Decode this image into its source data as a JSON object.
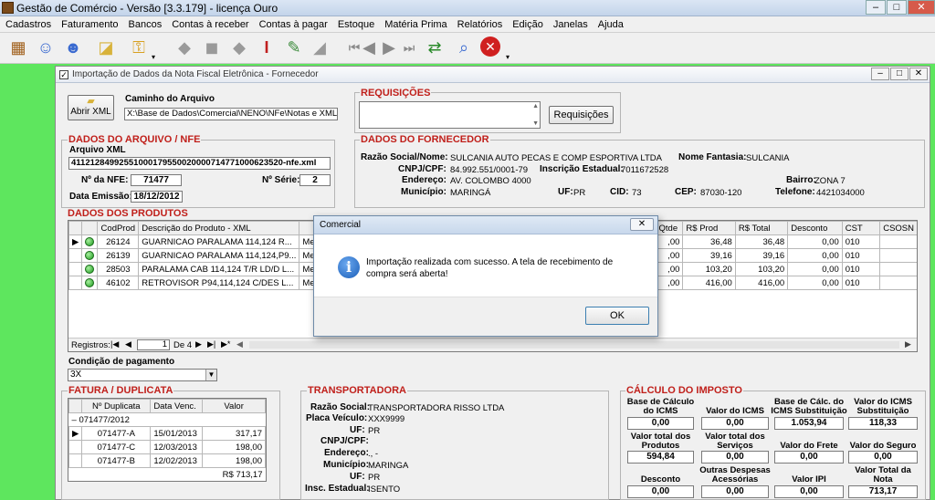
{
  "app": {
    "title": "Gestão de Comércio - Versão [3.3.179] - licença Ouro"
  },
  "menu": [
    "Cadastros",
    "Faturamento",
    "Bancos",
    "Contas à receber",
    "Contas à pagar",
    "Estoque",
    "Matéria Prima",
    "Relatórios",
    "Edição",
    "Janelas",
    "Ajuda"
  ],
  "window": {
    "title": "Importação de Dados da Nota Fiscal Eletrônica - Fornecedor"
  },
  "file": {
    "button": "Abrir XML",
    "label": "Caminho do Arquivo",
    "path": "X:\\Base de Dados\\Comercial\\NENO\\NFe\\Notas e XML recebi"
  },
  "requisicoes": {
    "title": "REQUISIÇÕES",
    "button": "Requisições"
  },
  "arquivo": {
    "title": "DADOS DO ARQUIVO / NFE",
    "xml_label": "Arquivo XML",
    "xml_value": "41121284992551000179550020000714771000623520-nfe.xml",
    "nfe_label": "Nº da NFE:",
    "nfe_value": "71477",
    "serie_label": "Nº Série:",
    "serie_value": "2",
    "emissao_label": "Data Emissão:",
    "emissao_value": "18/12/2012"
  },
  "fornecedor": {
    "title": "DADOS DO FORNECEDOR",
    "razao_label": "Razão Social/Nome:",
    "razao": "SULCANIA AUTO PECAS E COMP ESPORTIVA LTDA",
    "fantasia_label": "Nome Fantasia:",
    "fantasia": "SULCANIA",
    "cnpj_label": "CNPJ/CPF:",
    "cnpj": "84.992.551/0001-79",
    "ie_label": "Inscrição Estadual:",
    "ie": "7011672528",
    "endereco_label": "Endereço:",
    "endereco": "AV. COLOMBO 4000",
    "bairro_label": "Bairro:",
    "bairro": "ZONA 7",
    "municipio_label": "Município:",
    "municipio": "MARINGÁ",
    "uf_label": "UF:",
    "uf": "PR",
    "cid_label": "CID:",
    "cid": "73",
    "cep_label": "CEP:",
    "cep": "87030-120",
    "telefone_label": "Telefone:",
    "telefone": "4421034000"
  },
  "produtos": {
    "title": "DADOS DOS PRODUTOS",
    "headers": [
      "CodProd",
      "Descrição do Produto - XML",
      "Qtde",
      "R$ Prod",
      "R$ Total",
      "Desconto",
      "CST",
      "CSOSN"
    ],
    "rows": [
      {
        "cod": "26124",
        "desc": "GUARNICAO PARALAMA 114,124 R...",
        "merc": "Merca",
        "qtde": ",00",
        "prod": "36,48",
        "total": "36,48",
        "desc_val": "0,00",
        "cst": "010"
      },
      {
        "cod": "26139",
        "desc": "GUARNICAO PARALAMA 114,124,P9...",
        "merc": "Merca",
        "qtde": ",00",
        "prod": "39,16",
        "total": "39,16",
        "desc_val": "0,00",
        "cst": "010"
      },
      {
        "cod": "28503",
        "desc": "PARALAMA CAB 114,124 T/R LD/D L...",
        "merc": "Merca",
        "qtde": ",00",
        "prod": "103,20",
        "total": "103,20",
        "desc_val": "0,00",
        "cst": "010"
      },
      {
        "cod": "46102",
        "desc": "RETROVISOR P94,114,124 C/DES L...",
        "merc": "Merca",
        "qtde": ",00",
        "prod": "416,00",
        "total": "416,00",
        "desc_val": "0,00",
        "cst": "010"
      }
    ],
    "nav_label": "Registros:",
    "nav_current": "1",
    "nav_total": "De 4"
  },
  "pagamento": {
    "label": "Condição de pagamento",
    "value": "3X"
  },
  "fatura": {
    "title": "FATURA / DUPLICATA",
    "headers": [
      "Nº Duplicata",
      "Data Venc.",
      "Valor"
    ],
    "group": "071477/2012",
    "rows": [
      {
        "dup": "071477-A",
        "venc": "15/01/2013",
        "valor": "317,17"
      },
      {
        "dup": "071477-C",
        "venc": "12/03/2013",
        "valor": "198,00"
      },
      {
        "dup": "071477-B",
        "venc": "12/02/2013",
        "valor": "198,00"
      }
    ],
    "total": "R$ 713,17"
  },
  "transportadora": {
    "title": "TRANSPORTADORA",
    "razao_label": "Razão Social:",
    "razao": "TRANSPORTADORA RISSO LTDA",
    "placa_label": "Placa Veículo:",
    "placa": "XXX9999",
    "uf_label": "UF:",
    "uf": "PR",
    "cnpj_label": "CNPJ/CPF:",
    "cnpj": "",
    "endereco_label": "Endereço:",
    "endereco": "., -",
    "municipio_label": "Município:",
    "municipio": "MARINGA",
    "uf2_label": "UF:",
    "uf2": "PR",
    "ie_label": "Insc. Estadual:",
    "ie": "ISENTO"
  },
  "imposto": {
    "title": "CÁLCULO DO IMPOSTO",
    "base_icms_label": "Base de Cálculo do ICMS",
    "base_icms": "0,00",
    "icms_label": "Valor do ICMS",
    "icms": "0,00",
    "base_st_label": "Base de Cálc. do ICMS Substituição",
    "base_st": "1.053,94",
    "icms_st_label": "Valor do ICMS Substituição",
    "icms_st": "118,33",
    "prod_label": "Valor total dos Produtos",
    "prod": "594,84",
    "serv_label": "Valor total dos Serviços",
    "serv": "0,00",
    "frete_label": "Valor do Frete",
    "frete": "0,00",
    "seguro_label": "Valor do Seguro",
    "seguro": "0,00",
    "desconto_label": "Desconto",
    "desconto": "0,00",
    "outras_label": "Outras Despesas Acessórias",
    "outras": "0,00",
    "ipi_label": "Valor IPI",
    "ipi": "0,00",
    "total_label": "Valor Total da Nota",
    "total": "713,17"
  },
  "dialog": {
    "title": "Comercial",
    "message": "Importação realizada com sucesso. A tela de recebimento de compra será aberta!",
    "ok": "OK"
  }
}
